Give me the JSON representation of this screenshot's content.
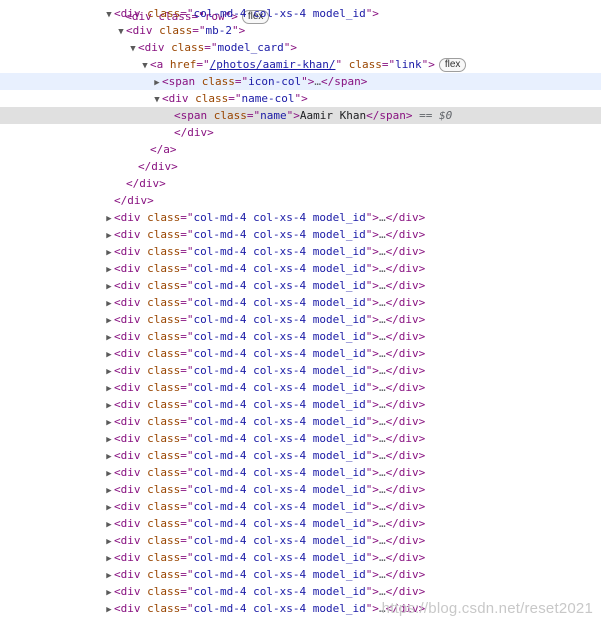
{
  "top_partial": {
    "text": "<div class=\"row\">",
    "badge": "flex"
  },
  "tree": {
    "model_id_open": {
      "tag": "div",
      "class_attr": "class",
      "class_value": "col-md-4 col-xs-4 model_id"
    },
    "mb2_open": {
      "tag": "div",
      "class_attr": "class",
      "class_value": "mb-2"
    },
    "model_card_open": {
      "tag": "div",
      "class_attr": "class",
      "class_value": "model_card"
    },
    "anchor_open": {
      "tag": "a",
      "href_attr": "href",
      "href_value": "/photos/aamir-khan/",
      "class_attr": "class",
      "class_value": "link",
      "badge": "flex"
    },
    "icon_col": {
      "tag": "span",
      "class_attr": "class",
      "class_value": "icon-col",
      "ellipsis": "…"
    },
    "name_col_open": {
      "tag": "div",
      "class_attr": "class",
      "class_value": "name-col"
    },
    "name_span": {
      "tag": "span",
      "class_attr": "class",
      "class_value": "name",
      "text": "Aamir Khan",
      "console_ref": "== $0"
    },
    "name_col_close": "</div>",
    "anchor_close": "</a>",
    "model_card_close": "</div>",
    "mb2_close": "</div>",
    "model_id_close": "</div>"
  },
  "collapsed_rows": {
    "tag": "div",
    "class_attr": "class",
    "class_value": "col-md-4 col-xs-4 model_id",
    "ellipsis": "…",
    "close": "</div>",
    "count": 24
  },
  "watermark": "https://blog.csdn.net/reset2021"
}
